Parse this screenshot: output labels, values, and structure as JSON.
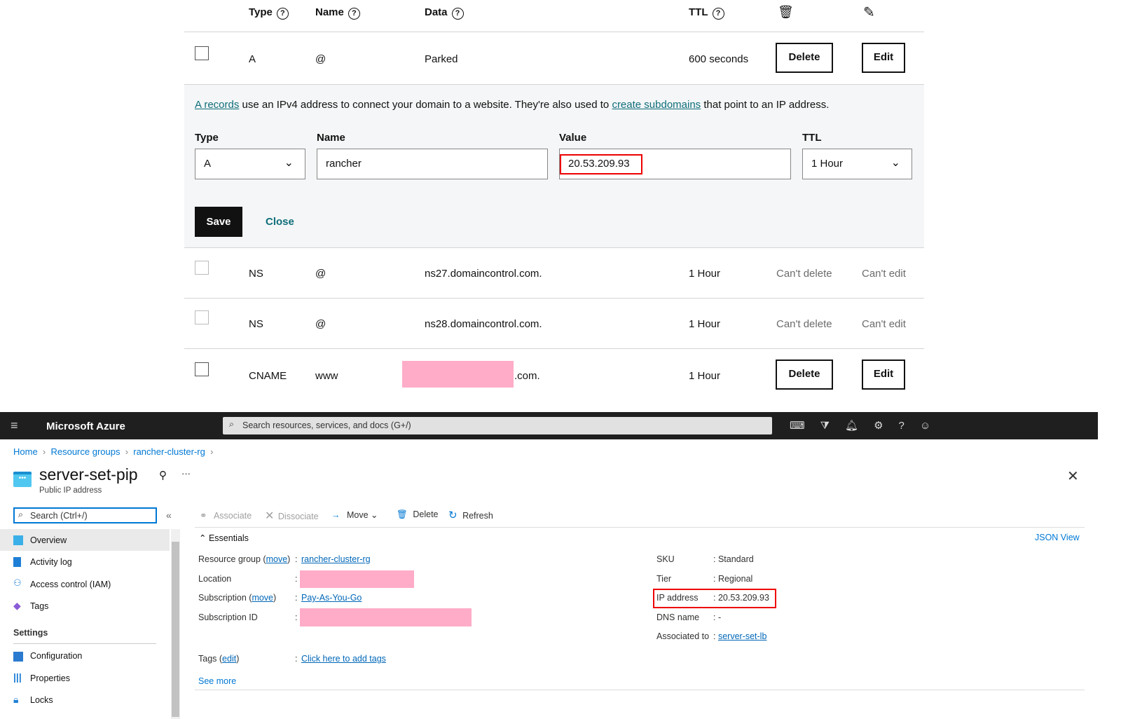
{
  "dns": {
    "headers": {
      "type": "Type",
      "name": "Name",
      "data": "Data",
      "ttl": "TTL"
    },
    "rows": [
      {
        "type": "A",
        "name": "@",
        "data": "Parked",
        "ttl": "600 seconds",
        "delete": "Delete",
        "edit": "Edit"
      },
      {
        "type": "NS",
        "name": "@",
        "data": "ns27.domaincontrol.com.",
        "ttl": "1 Hour",
        "delete": "Can't delete",
        "edit": "Can't edit"
      },
      {
        "type": "NS",
        "name": "@",
        "data": "ns28.domaincontrol.com.",
        "ttl": "1 Hour",
        "delete": "Can't delete",
        "edit": "Can't edit"
      },
      {
        "type": "CNAME",
        "name": "www",
        "data": ".com.",
        "ttl": "1 Hour",
        "delete": "Delete",
        "edit": "Edit"
      }
    ],
    "form": {
      "info_link1": "A records",
      "info_mid": " use an IPv4 address to connect your domain to a website. They're also used to ",
      "info_link2": "create subdomains",
      "info_end": " that point to an IP address.",
      "type_label": "Type",
      "type_value": "A",
      "name_label": "Name",
      "name_value": "rancher",
      "value_label": "Value",
      "value_value": "20.53.209.93",
      "ttl_label": "TTL",
      "ttl_value": "1 Hour",
      "save": "Save",
      "close": "Close"
    }
  },
  "azure": {
    "brand": "Microsoft Azure",
    "search_placeholder": "Search resources, services, and docs (G+/)",
    "breadcrumb": [
      "Home",
      "Resource groups",
      "rancher-cluster-rg"
    ],
    "title": "server-set-pip",
    "subtitle": "Public IP address",
    "more": "···",
    "side_search": "Search (Ctrl+/)",
    "nav": [
      "Overview",
      "Activity log",
      "Access control (IAM)",
      "Tags"
    ],
    "settings": "Settings",
    "settings_nav": [
      "Configuration",
      "Properties",
      "Locks"
    ],
    "toolbar": {
      "associate": "Associate",
      "dissociate": "Dissociate",
      "move": "Move",
      "delete": "Delete",
      "refresh": "Refresh"
    },
    "essentials": "Essentials",
    "json_view": "JSON View",
    "left": {
      "rg_label": "Resource group",
      "move": "move",
      "rg_value": "rancher-cluster-rg",
      "location_label": "Location",
      "sub_label": "Subscription",
      "sub_value": "Pay-As-You-Go",
      "subid_label": "Subscription ID",
      "tags_label": "Tags",
      "edit": "edit",
      "tags_value": "Click here to add tags",
      "see_more": "See more"
    },
    "right": {
      "sku_label": "SKU",
      "sku": "Standard",
      "tier_label": "Tier",
      "tier": "Regional",
      "ip_label": "IP address",
      "ip": "20.53.209.93",
      "dns_label": "DNS name",
      "dns": "-",
      "assoc_label": "Associated to",
      "assoc": "server-set-lb"
    }
  }
}
